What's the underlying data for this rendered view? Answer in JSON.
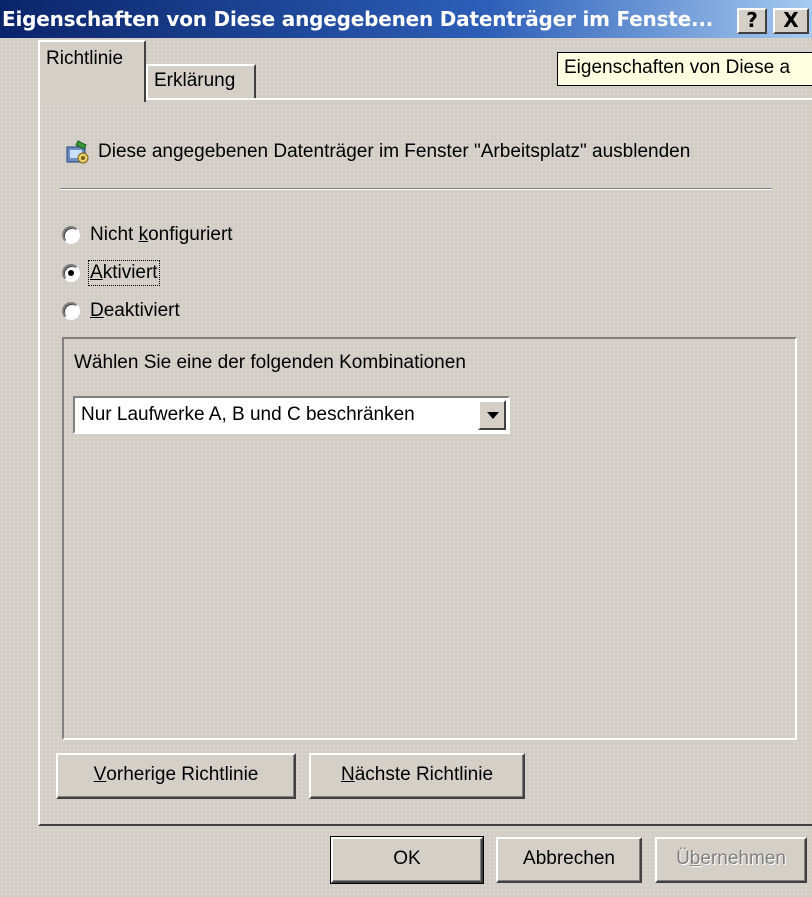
{
  "window": {
    "title": "Eigenschaften von Diese angegebenen Datenträger im Fenste...",
    "help_glyph": "?",
    "close_glyph": "X"
  },
  "tabs": [
    {
      "label": "Richtlinie",
      "active": true
    },
    {
      "label": "Erklärung",
      "active": false
    }
  ],
  "tooltip": {
    "text": "Eigenschaften von Diese a"
  },
  "policy": {
    "icon": "policy-setting-icon",
    "title": "Diese angegebenen Datenträger im Fenster \"Arbeitsplatz\" ausblenden"
  },
  "options": {
    "not_configured": {
      "pre": "Nicht ",
      "accel": "k",
      "post": "onfiguriert",
      "checked": false
    },
    "enabled": {
      "pre": "",
      "accel": "A",
      "post": "ktiviert",
      "checked": true
    },
    "disabled": {
      "pre": "",
      "accel": "D",
      "post": "eaktiviert",
      "checked": false
    }
  },
  "combination": {
    "label": "Wählen Sie eine der folgenden Kombinationen",
    "selected": "Nur Laufwerke A, B und C beschränken"
  },
  "nav_buttons": {
    "previous": {
      "accel": "V",
      "post": "orherige Richtlinie"
    },
    "next": {
      "accel": "N",
      "post": "ächste Richtlinie"
    }
  },
  "dialog_buttons": {
    "ok": "OK",
    "cancel": "Abbrechen",
    "apply": {
      "pre": "Ü",
      "accel": "b",
      "post": "ernehmen",
      "enabled": false
    }
  },
  "colors": {
    "titlebar_start": "#0a246a",
    "titlebar_end": "#a6caf0",
    "face": "#d4d0c8",
    "tooltip_bg": "#ffffe1"
  }
}
